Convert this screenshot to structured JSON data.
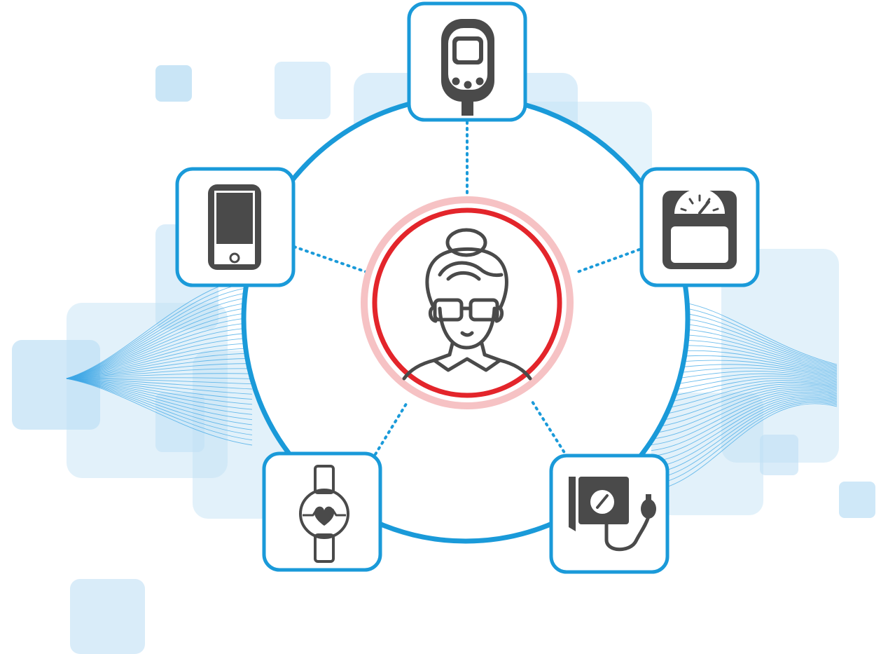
{
  "diagram": {
    "center": {
      "icon": "elderly-woman-with-glasses-icon"
    },
    "devices": [
      {
        "id": "glucose-meter",
        "icon": "glucose-meter-icon"
      },
      {
        "id": "weight-scale",
        "icon": "weight-scale-icon"
      },
      {
        "id": "blood-pressure-monitor",
        "icon": "blood-pressure-cuff-icon"
      },
      {
        "id": "smartwatch",
        "icon": "heart-rate-watch-icon"
      },
      {
        "id": "smartphone",
        "icon": "smartphone-icon"
      }
    ]
  },
  "colors": {
    "ring": "#1a9ad9",
    "connector": "#1a9ad9",
    "tile_border": "#1a9ad9",
    "tile_fill": "#ffffff",
    "icon": "#4a4a4a",
    "center_ring": "#e3252b",
    "center_halo": "#f6c2c4",
    "background_squares": "#bfe0f5",
    "data_streams": "#3ea7e6"
  }
}
